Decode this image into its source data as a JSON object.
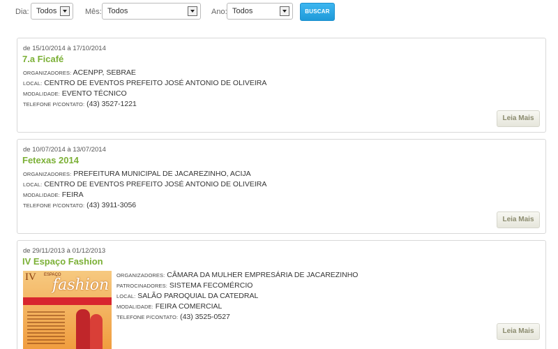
{
  "filters": {
    "day": {
      "label": "Dia:",
      "value": "Todos"
    },
    "month": {
      "label": "Mês:",
      "value": "Todos"
    },
    "year": {
      "label": "Ano:",
      "value": "Todos"
    },
    "search_label": "BUSCAR"
  },
  "labels": {
    "organizers": "Organizadores:",
    "sponsors": "Patrocinadores:",
    "location": "Local:",
    "modality": "Modalidade:",
    "phone": "Telefone p/contato:",
    "read_more": "Leia Mais"
  },
  "events": [
    {
      "dates": "de 15/10/2014 à 17/10/2014",
      "title": "7.a Ficafé",
      "organizers": "ACENPP, SEBRAE",
      "location": "CENTRO DE EVENTOS PREFEITO JOSÉ ANTONIO DE OLIVEIRA",
      "modality": "EVENTO TÉCNICO",
      "phone": "(43) 3527-1221"
    },
    {
      "dates": "de 10/07/2014 à 13/07/2014",
      "title": "Fetexas 2014",
      "organizers": "PREFEITURA MUNICIPAL DE JACAREZINHO, ACIJA",
      "location": "CENTRO DE EVENTOS PREFEITO JOSÉ ANTONIO DE OLIVEIRA",
      "modality": "FEIRA",
      "phone": "(43) 3911-3056"
    },
    {
      "dates": "de 29/11/2013 à 01/12/2013",
      "title": "IV Espaço Fashion",
      "organizers": "CÂMARA DA MULHER EMPRESÁRIA DE JACAREZINHO",
      "sponsors": "SISTEMA FECOMÉRCIO",
      "location": "SALÃO PAROQUIAL DA CATEDRAL",
      "modality": "FEIRA COMERCIAL",
      "phone": "(43) 3525-0527",
      "poster": {
        "line1": "IV",
        "line2": "ESPAÇO",
        "line3": "fashion"
      }
    }
  ]
}
